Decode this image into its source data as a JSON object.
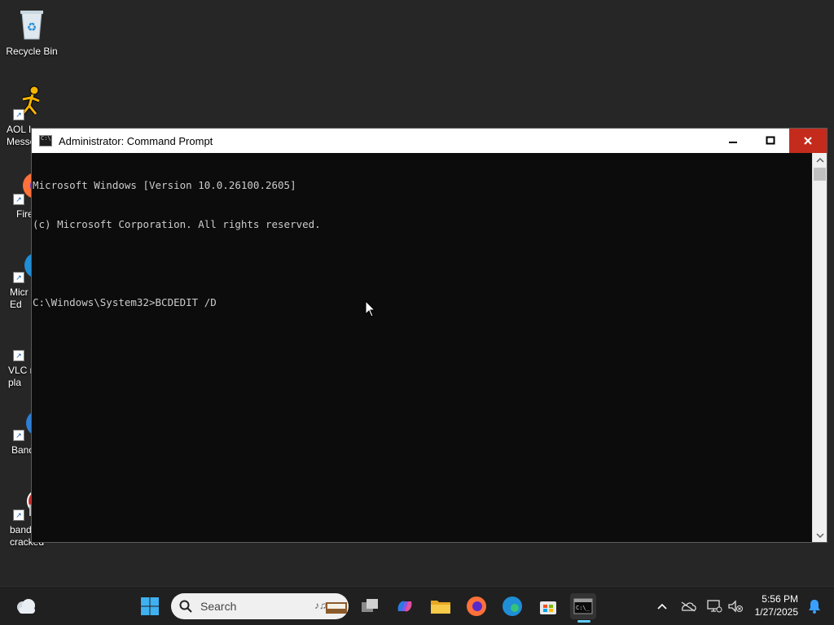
{
  "desktop": {
    "icons": [
      {
        "label": "Recycle Bin",
        "icon": "recycle-bin-icon"
      },
      {
        "label": "AOL I\nMesse",
        "icon": "aol-messenger-icon"
      },
      {
        "label": "Fire",
        "icon": "firefox-icon"
      },
      {
        "label": "Micr\nEd",
        "icon": "edge-icon"
      },
      {
        "label": "VLC m\npla",
        "icon": "vlc-icon"
      },
      {
        "label": "Band",
        "icon": "bandicam-icon"
      },
      {
        "label": "band\ncracked",
        "icon": "bandicam-cracked-icon"
      }
    ]
  },
  "window": {
    "title": "Administrator: Command Prompt",
    "controls": {
      "minimize": "—",
      "maximize": "▢",
      "close": "✕"
    },
    "console_lines": [
      "Microsoft Windows [Version 10.0.26100.2605]",
      "(c) Microsoft Corporation. All rights reserved.",
      "",
      "C:\\Windows\\System32>BCDEDIT /D"
    ]
  },
  "taskbar": {
    "search_placeholder": "Search",
    "apps": [
      "start-icon",
      "task-view-icon",
      "copilot-icon",
      "file-explorer-icon",
      "firefox-icon",
      "edge-icon",
      "store-icon",
      "terminal-icon"
    ],
    "tray": {
      "chevron": "^"
    },
    "time": "5:56 PM",
    "date": "1/27/2025"
  },
  "colors": {
    "accent": "#60cdff",
    "close": "#c42b1c",
    "console_bg": "#0c0c0c",
    "console_text": "#cccccc"
  }
}
